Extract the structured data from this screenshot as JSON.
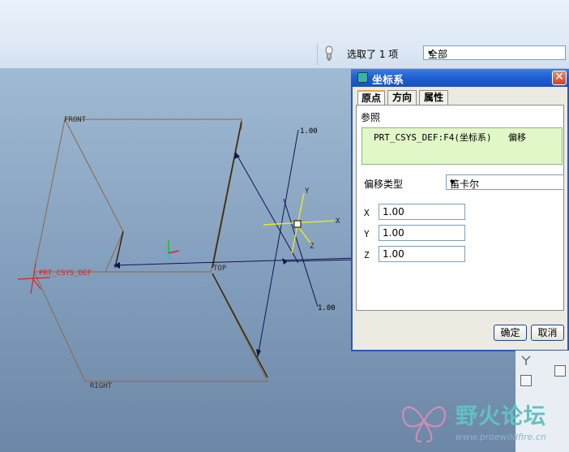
{
  "status": {
    "selected_text": "选取了 1 项"
  },
  "filter": {
    "value": "全部"
  },
  "graphics": {
    "datum_front": "FRONT",
    "datum_top": "TOP",
    "datum_right": "RIGHT",
    "csys_name": "PRT_CSYS_DEF",
    "dim_1": "1.00",
    "dim_2": "1.00",
    "axis_x": "X",
    "axis_y": "Y",
    "axis_z": "Z"
  },
  "dialog": {
    "title": "坐标系",
    "tabs": [
      "原点",
      "方向",
      "属性"
    ],
    "reference_label": "参照",
    "reference_name": "PRT_CSYS_DEF:F4(坐标系)",
    "reference_type": "偏移",
    "offset_type_label": "偏移类型",
    "offset_type_value": "笛卡尔",
    "fields": [
      {
        "label": "X",
        "value": "1.00"
      },
      {
        "label": "Y",
        "value": "1.00"
      },
      {
        "label": "Z",
        "value": "1.00"
      }
    ],
    "ok_label": "确定",
    "cancel_label": "取消"
  },
  "watermark": {
    "name": "野火论坛",
    "url": "www.proewildfire.cn"
  },
  "colors": {
    "title_blue": "#1e5dd3",
    "datum_brown": "#8a6a48",
    "csys_red": "#e02020",
    "csys_yellow": "#e8e820"
  }
}
